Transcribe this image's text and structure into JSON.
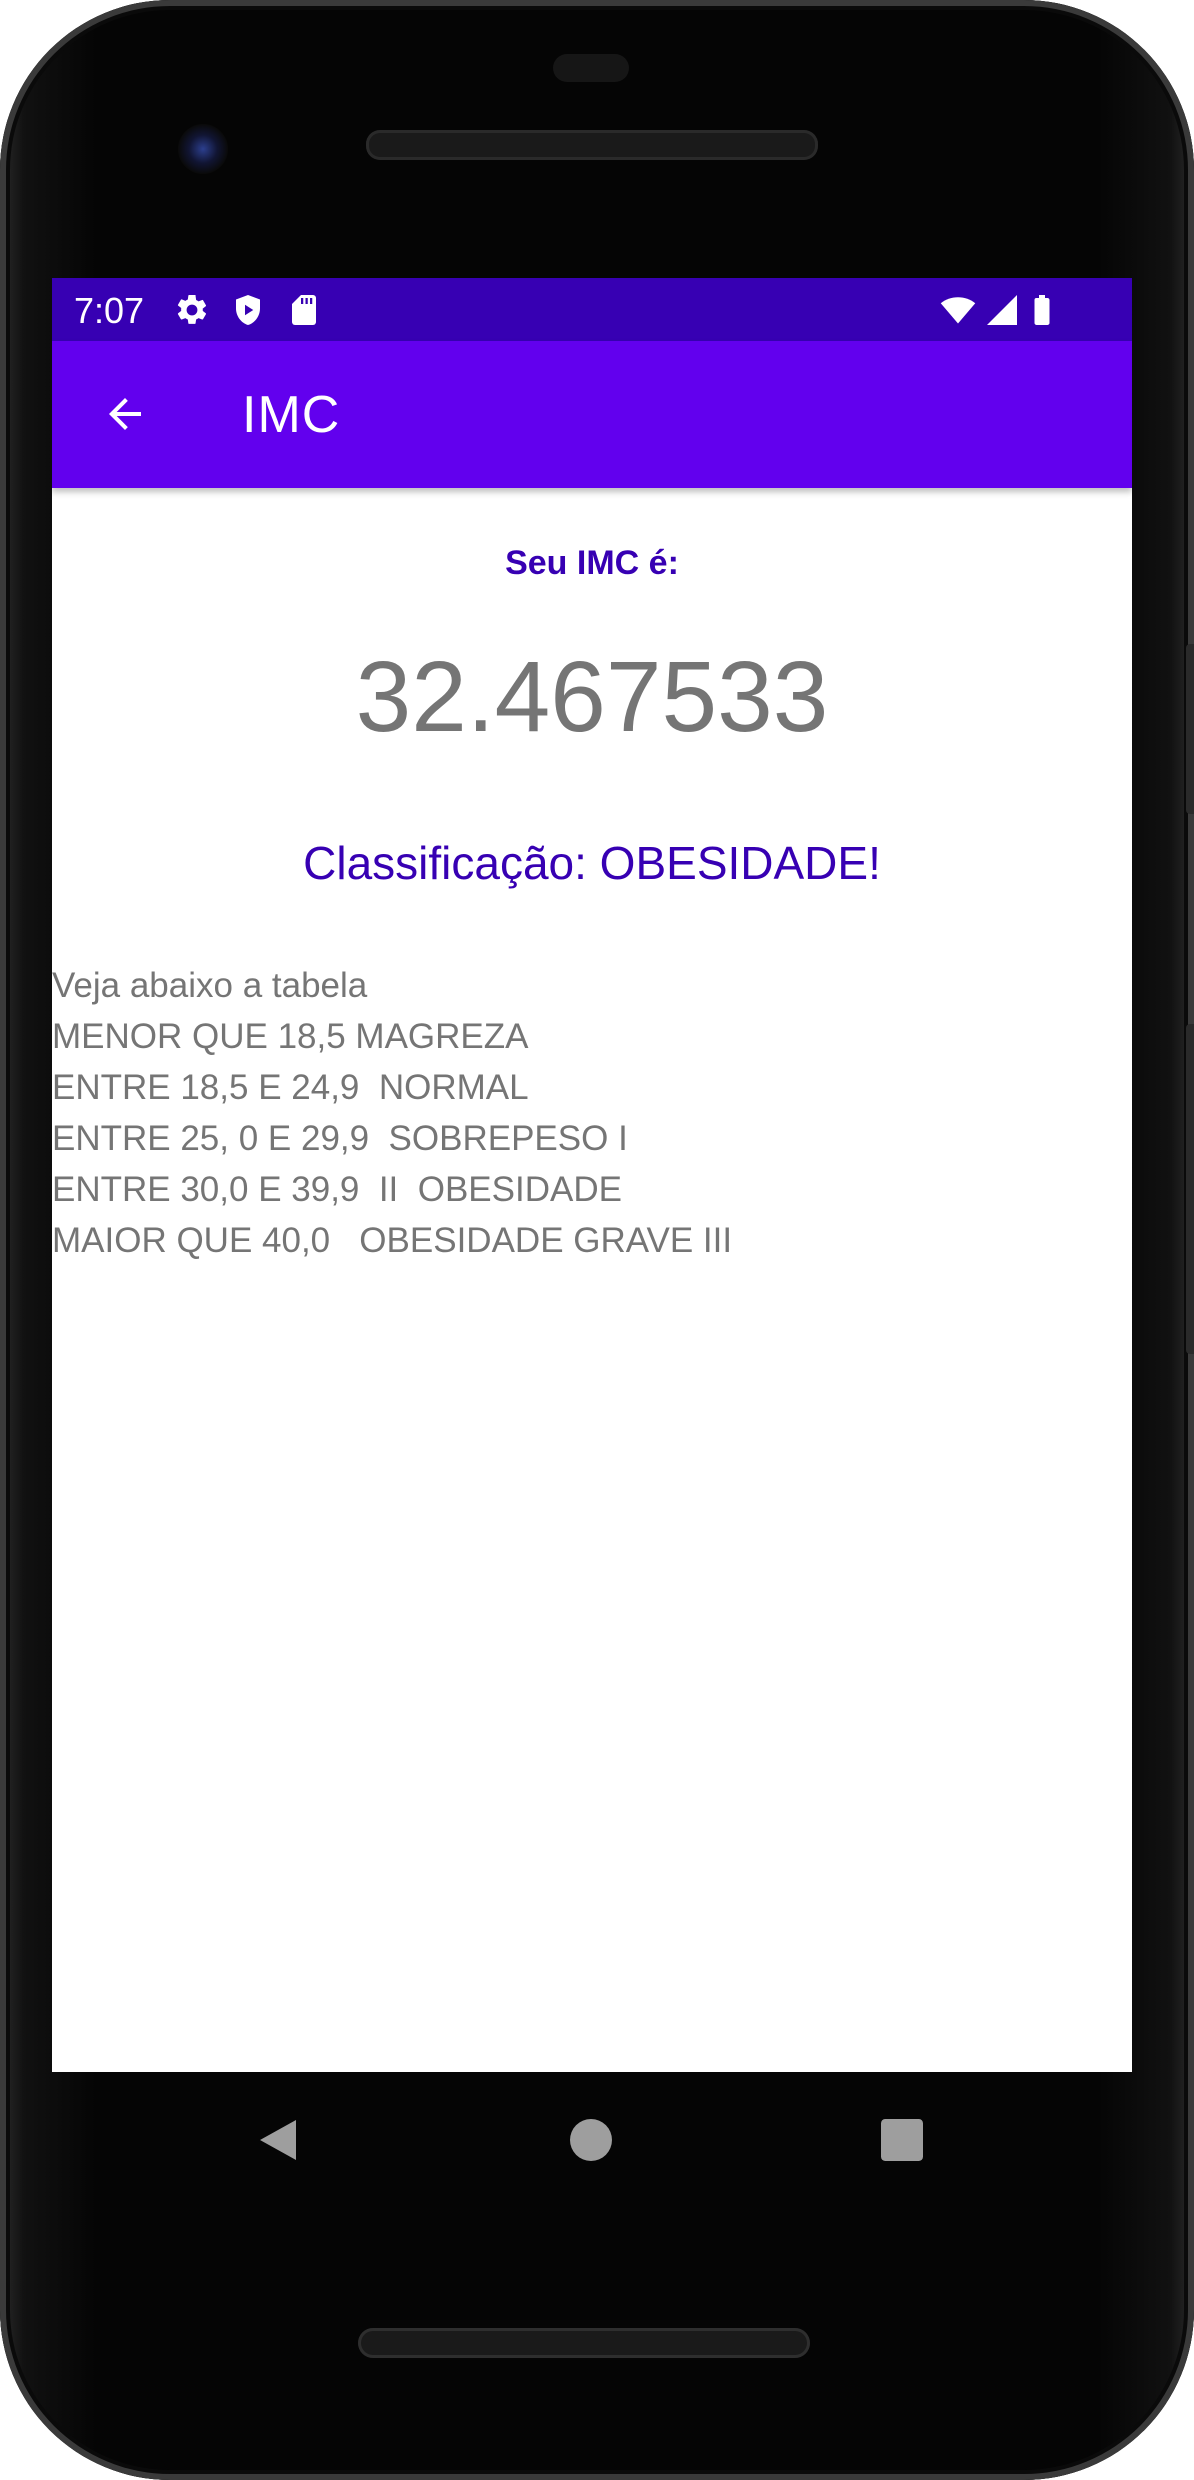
{
  "status_bar": {
    "time": "7:07",
    "left_icons": [
      "gear-icon",
      "shield-play-icon",
      "sd-card-icon"
    ],
    "right_icons": [
      "wifi-icon",
      "signal-icon",
      "battery-icon"
    ],
    "background_color": "#3700b3"
  },
  "app_bar": {
    "title": "IMC",
    "back_icon": "arrow-back-icon",
    "background_color": "#6200ee"
  },
  "result": {
    "label": "Seu IMC é:",
    "value": "32.467533",
    "classification": "Classificação: OBESIDADE!",
    "accent_color": "#3700b3"
  },
  "table": {
    "lines": [
      "Veja abaixo a tabela",
      "MENOR QUE 18,5 MAGREZA",
      "ENTRE 18,5 E 24,9  NORMAL",
      "ENTRE 25, 0 E 29,9  SOBREPESO I",
      "ENTRE 30,0 E 39,9  II  OBESIDADE",
      "MAIOR QUE 40,0   OBESIDADE GRAVE III"
    ]
  },
  "nav_bar": {
    "buttons": [
      "back-triangle-icon",
      "home-circle-icon",
      "recents-square-icon"
    ]
  }
}
